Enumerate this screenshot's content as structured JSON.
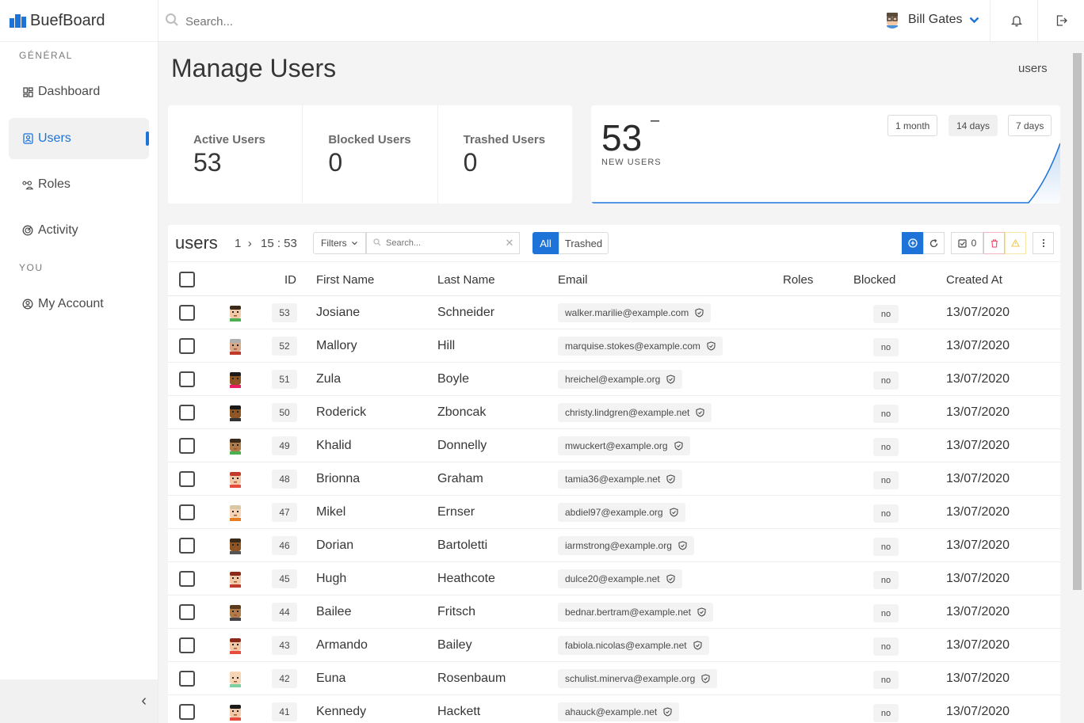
{
  "brand": {
    "name": "BuefBoard"
  },
  "sidebar": {
    "section_general": "GÉNÉRAL",
    "section_you": "YOU",
    "items": [
      {
        "label": "Dashboard",
        "icon": "dashboard-icon"
      },
      {
        "label": "Users",
        "icon": "users-icon",
        "active": true
      },
      {
        "label": "Roles",
        "icon": "roles-icon"
      },
      {
        "label": "Activity",
        "icon": "activity-icon"
      },
      {
        "label": "My Account",
        "icon": "account-icon"
      }
    ],
    "collapse_icon": "‹"
  },
  "topbar": {
    "search_placeholder": "Search...",
    "user_name": "Bill Gates"
  },
  "page": {
    "title": "Manage Users",
    "breadcrumb": "users"
  },
  "stats": [
    {
      "label": "Active Users",
      "value": "53"
    },
    {
      "label": "Blocked Users",
      "value": "0"
    },
    {
      "label": "Trashed Users",
      "value": "0"
    }
  ],
  "new_users": {
    "value": "53",
    "trend": "–",
    "label": "NEW USERS",
    "ranges": [
      "1 month",
      "14 days",
      "7 days"
    ],
    "selected_range": "14 days"
  },
  "table": {
    "title": "users",
    "page": "1",
    "page_sep": "›",
    "time": "15 : 53",
    "filters_label": "Filters",
    "search_placeholder": "Search...",
    "clear_label": "✕",
    "seg_all": "All",
    "seg_trashed": "Trashed",
    "selected_count": "0",
    "columns": [
      "ID",
      "First Name",
      "Last Name",
      "Email",
      "Roles",
      "Blocked",
      "Created At"
    ],
    "rows": [
      {
        "id": "53",
        "first": "Josiane",
        "last": "Schneider",
        "email": "walker.marilie@example.com",
        "blocked": "no",
        "created": "13/07/2020",
        "skin": "#f2c9a8",
        "hair": "#3a2a1a",
        "shirt": "#4caf50"
      },
      {
        "id": "52",
        "first": "Mallory",
        "last": "Hill",
        "email": "marquise.stokes@example.com",
        "blocked": "no",
        "created": "13/07/2020",
        "skin": "#d8a88a",
        "hair": "#b0b0b0",
        "shirt": "#c0392b"
      },
      {
        "id": "51",
        "first": "Zula",
        "last": "Boyle",
        "email": "hreichel@example.org",
        "blocked": "no",
        "created": "13/07/2020",
        "skin": "#8d5524",
        "hair": "#1a1a1a",
        "shirt": "#e91e63"
      },
      {
        "id": "50",
        "first": "Roderick",
        "last": "Zboncak",
        "email": "christy.lindgren@example.net",
        "blocked": "no",
        "created": "13/07/2020",
        "skin": "#8d5524",
        "hair": "#1a1a1a",
        "shirt": "#333333"
      },
      {
        "id": "49",
        "first": "Khalid",
        "last": "Donnelly",
        "email": "mwuckert@example.org",
        "blocked": "no",
        "created": "13/07/2020",
        "skin": "#b07b4a",
        "hair": "#3a2a1a",
        "shirt": "#4caf50"
      },
      {
        "id": "48",
        "first": "Brionna",
        "last": "Graham",
        "email": "tamia36@example.net",
        "blocked": "no",
        "created": "13/07/2020",
        "skin": "#f2c9a8",
        "hair": "#c0392b",
        "shirt": "#e74c3c"
      },
      {
        "id": "47",
        "first": "Mikel",
        "last": "Ernser",
        "email": "abdiel97@example.org",
        "blocked": "no",
        "created": "13/07/2020",
        "skin": "#f5d5b5",
        "hair": "#d8c8a8",
        "shirt": "#e67e22"
      },
      {
        "id": "46",
        "first": "Dorian",
        "last": "Bartoletti",
        "email": "iarmstrong@example.org",
        "blocked": "no",
        "created": "13/07/2020",
        "skin": "#8d5524",
        "hair": "#3a2a1a",
        "shirt": "#555555"
      },
      {
        "id": "45",
        "first": "Hugh",
        "last": "Heathcote",
        "email": "dulce20@example.net",
        "blocked": "no",
        "created": "13/07/2020",
        "skin": "#f2c9a8",
        "hair": "#8b2a1a",
        "shirt": "#c0392b"
      },
      {
        "id": "44",
        "first": "Bailee",
        "last": "Fritsch",
        "email": "bednar.bertram@example.net",
        "blocked": "no",
        "created": "13/07/2020",
        "skin": "#b07b4a",
        "hair": "#5a3a1a",
        "shirt": "#444444"
      },
      {
        "id": "43",
        "first": "Armando",
        "last": "Bailey",
        "email": "fabiola.nicolas@example.net",
        "blocked": "no",
        "created": "13/07/2020",
        "skin": "#f2c9a8",
        "hair": "#8b2a1a",
        "shirt": "#e74c3c"
      },
      {
        "id": "42",
        "first": "Euna",
        "last": "Rosenbaum",
        "email": "schulist.minerva@example.org",
        "blocked": "no",
        "created": "13/07/2020",
        "skin": "#f5d5b5",
        "hair": "#f5d5b5",
        "shirt": "#7dcea0"
      },
      {
        "id": "41",
        "first": "Kennedy",
        "last": "Hackett",
        "email": "ahauck@example.net",
        "blocked": "no",
        "created": "13/07/2020",
        "skin": "#f2c9a8",
        "hair": "#1a1a1a",
        "shirt": "#e74c3c"
      }
    ]
  },
  "colors": {
    "accent": "#1e73d8",
    "danger": "#f14668",
    "warning": "#ffdd57"
  }
}
